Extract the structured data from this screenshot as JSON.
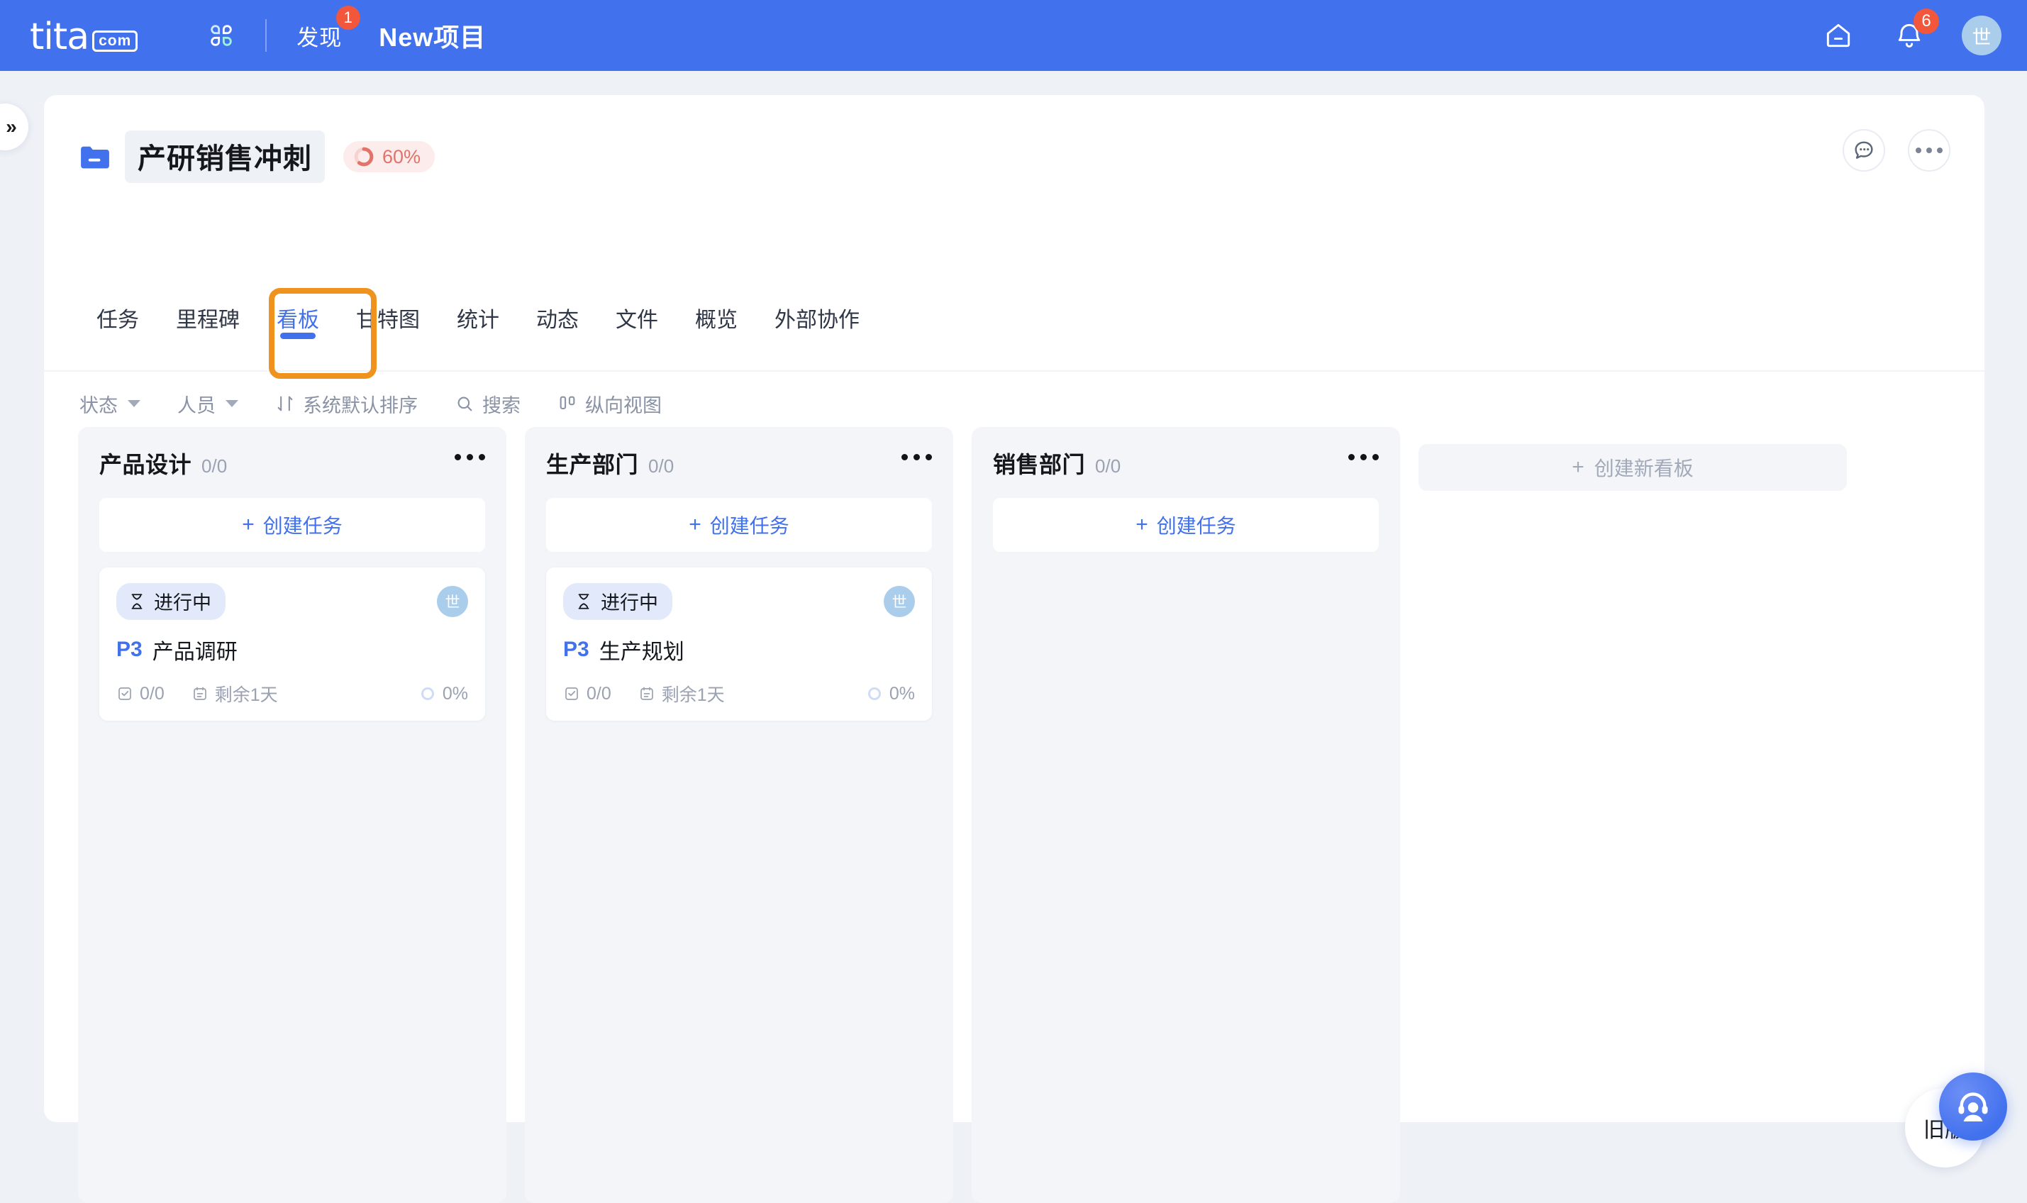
{
  "topnav": {
    "logo_word": "tita",
    "logo_suffix": "com",
    "grid_icon": "apps-grid-icon",
    "discover_label": "发现",
    "discover_badge": "1",
    "project_switcher_label": "New项目",
    "home_icon": "home-icon",
    "bell_icon": "bell-icon",
    "bell_badge": "6",
    "avatar_initial": "世"
  },
  "left_rail": {
    "expand_icon": "double-chevron-right-icon",
    "expand_glyph": "»"
  },
  "project": {
    "folder_icon": "folder-icon",
    "name": "产研销售冲刺",
    "progress_label": "60%",
    "progress_value": 60,
    "comment_icon": "comment-bubble-icon",
    "more_icon": "more-horizontal-icon"
  },
  "tabs": [
    {
      "label": "任务",
      "active": false
    },
    {
      "label": "里程碑",
      "active": false
    },
    {
      "label": "看板",
      "active": true
    },
    {
      "label": "甘特图",
      "active": false
    },
    {
      "label": "统计",
      "active": false
    },
    {
      "label": "动态",
      "active": false
    },
    {
      "label": "文件",
      "active": false
    },
    {
      "label": "概览",
      "active": false
    },
    {
      "label": "外部协作",
      "active": false
    }
  ],
  "toolbar": {
    "status_label": "状态",
    "member_label": "人员",
    "sort_icon": "sort-icon",
    "sort_label": "系统默认排序",
    "search_icon": "search-icon",
    "search_label": "搜索",
    "view_icon": "vertical-view-icon",
    "view_label": "纵向视图"
  },
  "board": {
    "create_task_label": "创建任务",
    "add_board_label": "创建新看板",
    "columns": [
      {
        "name": "产品设计",
        "count": "0/0",
        "cards": [
          {
            "status_icon": "hourglass-icon",
            "status": "进行中",
            "priority": "P3",
            "title": "产品调研",
            "subtask_icon": "checklist-icon",
            "subtasks": "0/0",
            "date_icon": "calendar-icon",
            "due": "剩余1天",
            "progress_icon": "progress-ring-icon",
            "progress": "0%",
            "assignee_initial": "世"
          }
        ]
      },
      {
        "name": "生产部门",
        "count": "0/0",
        "cards": [
          {
            "status_icon": "hourglass-icon",
            "status": "进行中",
            "priority": "P3",
            "title": "生产规划",
            "subtask_icon": "checklist-icon",
            "subtasks": "0/0",
            "date_icon": "calendar-icon",
            "due": "剩余1天",
            "progress_icon": "progress-ring-icon",
            "progress": "0%",
            "assignee_initial": "世"
          }
        ]
      },
      {
        "name": "销售部门",
        "count": "0/0",
        "cards": []
      }
    ]
  },
  "floating": {
    "old_version_label": "旧版",
    "support_icon": "headset-support-icon"
  },
  "colors": {
    "brand_blue": "#4271ee",
    "highlight_orange": "#f0921e",
    "badge_red": "#f3573b",
    "progress_pill_text": "#e2726a",
    "column_bg": "#f3f5f9",
    "page_bg": "#eef1f6"
  }
}
